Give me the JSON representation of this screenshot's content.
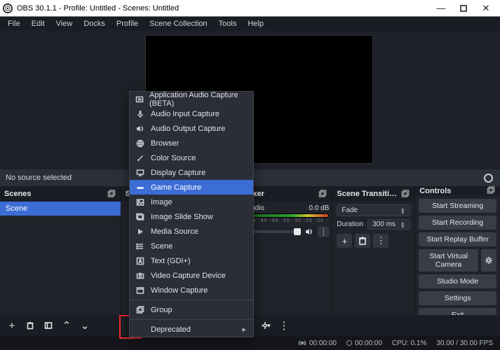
{
  "window": {
    "title": "OBS 30.1.1 - Profile: Untitled - Scenes: Untitled"
  },
  "menus": [
    "File",
    "Edit",
    "View",
    "Docks",
    "Profile",
    "Scene Collection",
    "Tools",
    "Help"
  ],
  "nosource_text": "No source selected",
  "docks": {
    "scenes_title": "Scenes",
    "sources_title": "So",
    "mixer_title": "lixer",
    "transition_title": "Scene Transiti…",
    "controls_title": "Controls"
  },
  "scenes": {
    "items": [
      {
        "label": "Scene"
      }
    ]
  },
  "mixer": {
    "track_label": "ṇudio",
    "level_db": "0.0 dB"
  },
  "transition": {
    "selected": "Fade",
    "duration_label": "Duration",
    "duration_value": "300 ms"
  },
  "controls": {
    "start_streaming": "Start Streaming",
    "start_recording": "Start Recording",
    "start_replay": "Start Replay Buffer",
    "start_vcam": "Start Virtual Camera",
    "studio_mode": "Studio Mode",
    "settings": "Settings",
    "exit": "Exit"
  },
  "status": {
    "live_time": "00:00:00",
    "rec_time": "00:00:00",
    "cpu": "CPU: 0.1%",
    "fps": "30.00 / 30.00 FPS"
  },
  "add_menu": {
    "items": [
      {
        "id": "app-audio",
        "label": "Application Audio Capture (BETA)"
      },
      {
        "id": "audio-in",
        "label": "Audio Input Capture"
      },
      {
        "id": "audio-out",
        "label": "Audio Output Capture"
      },
      {
        "id": "browser",
        "label": "Browser"
      },
      {
        "id": "color",
        "label": "Color Source"
      },
      {
        "id": "display",
        "label": "Display Capture"
      },
      {
        "id": "game",
        "label": "Game Capture"
      },
      {
        "id": "image",
        "label": "Image"
      },
      {
        "id": "slideshow",
        "label": "Image Slide Show"
      },
      {
        "id": "media",
        "label": "Media Source"
      },
      {
        "id": "scene",
        "label": "Scene"
      },
      {
        "id": "text",
        "label": "Text (GDI+)"
      },
      {
        "id": "vcapture",
        "label": "Video Capture Device"
      },
      {
        "id": "window",
        "label": "Window Capture"
      }
    ],
    "group_label": "Group",
    "deprecated_label": "Deprecated"
  }
}
